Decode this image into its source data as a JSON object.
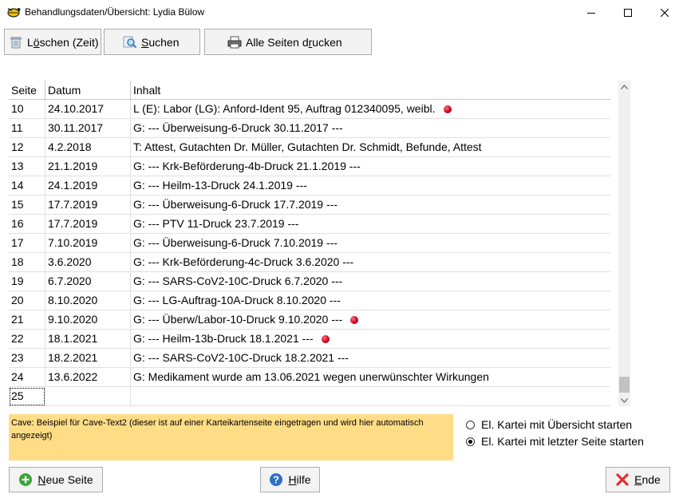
{
  "window": {
    "title": "Behandlungsdaten/Übersicht: Lydia Bülow"
  },
  "toolbar": {
    "delete_label_pre": "L",
    "delete_label_u": "ö",
    "delete_label_post": "schen (Zeit)",
    "search_label_pre": "",
    "search_label_u": "S",
    "search_label_post": "uchen",
    "print_label_pre": "Alle Seiten d",
    "print_label_u": "r",
    "print_label_post": "ucken"
  },
  "table": {
    "headers": [
      "Seite",
      "Datum",
      "Inhalt"
    ],
    "rows": [
      {
        "seite": "10",
        "datum": "24.10.2017",
        "inhalt": "L (E): Labor (LG): Anford-Ident 95, Auftrag 012340095, weibl.",
        "marker": true
      },
      {
        "seite": "11",
        "datum": "30.11.2017",
        "inhalt": "G: --- Überweisung-6-Druck 30.11.2017 ---",
        "marker": false
      },
      {
        "seite": "12",
        "datum": "4.2.2018",
        "inhalt": "T: Attest, Gutachten Dr. Müller, Gutachten Dr. Schmidt, Befunde, Attest",
        "marker": false
      },
      {
        "seite": "13",
        "datum": "21.1.2019",
        "inhalt": "G: --- Krk-Beförderung-4b-Druck 21.1.2019 ---",
        "marker": false
      },
      {
        "seite": "14",
        "datum": "24.1.2019",
        "inhalt": "G: --- Heilm-13-Druck 24.1.2019 ---",
        "marker": false
      },
      {
        "seite": "15",
        "datum": "17.7.2019",
        "inhalt": "G: --- Überweisung-6-Druck 17.7.2019 ---",
        "marker": false
      },
      {
        "seite": "16",
        "datum": "17.7.2019",
        "inhalt": "G: --- PTV 11-Druck 23.7.2019 ---",
        "marker": false
      },
      {
        "seite": "17",
        "datum": "7.10.2019",
        "inhalt": "G: --- Überweisung-6-Druck 7.10.2019 ---",
        "marker": false
      },
      {
        "seite": "18",
        "datum": "3.6.2020",
        "inhalt": "G: --- Krk-Beförderung-4c-Druck 3.6.2020 ---",
        "marker": false
      },
      {
        "seite": "19",
        "datum": "6.7.2020",
        "inhalt": "G: --- SARS-CoV2-10C-Druck 6.7.2020 ---",
        "marker": false
      },
      {
        "seite": "20",
        "datum": "8.10.2020",
        "inhalt": "G: --- LG-Auftrag-10A-Druck 8.10.2020 ---",
        "marker": false
      },
      {
        "seite": "21",
        "datum": "9.10.2020",
        "inhalt": "G: --- Überw/Labor-10-Druck 9.10.2020 ---",
        "marker": true
      },
      {
        "seite": "22",
        "datum": "18.1.2021",
        "inhalt": "G: --- Heilm-13b-Druck 18.1.2021 ---",
        "marker": true
      },
      {
        "seite": "23",
        "datum": "18.2.2021",
        "inhalt": "G: --- SARS-CoV2-10C-Druck 18.2.2021 ---",
        "marker": false
      },
      {
        "seite": "24",
        "datum": "13.6.2022",
        "inhalt": "G: Medikament wurde am 13.06.2021 wegen unerwünschter Wirkungen",
        "marker": false
      },
      {
        "seite": "25",
        "datum": "",
        "inhalt": "",
        "marker": false,
        "editing": true
      }
    ]
  },
  "cave": {
    "text": "Cave: Beispiel für Cave-Text2 (dieser ist auf einer Karteikartenseite eingetragen und wird hier automatisch angezeigt)"
  },
  "options": {
    "radio1_label": "El. Kartei mit Übersicht starten",
    "radio1_checked": false,
    "radio2_label": "El. Kartei mit letzter Seite starten",
    "radio2_checked": true
  },
  "footer": {
    "new_label_pre": "",
    "new_label_u": "N",
    "new_label_post": "eue Seite",
    "help_label_pre": "",
    "help_label_u": "H",
    "help_label_post": "ilfe",
    "end_label_pre": "",
    "end_label_u": "E",
    "end_label_post": "nde"
  },
  "colors": {
    "cave_bg": "#ffdd87",
    "marker": "#c4001c",
    "new_icon": "#3aa53a",
    "help_icon": "#2f6fc4",
    "end_icon": "#e03030"
  },
  "icons": {
    "app": "tortoise-icon",
    "delete": "trash-icon",
    "search": "search-icon",
    "print": "printer-icon",
    "new": "plus-circle-icon",
    "help": "help-icon",
    "end": "close-x-icon"
  }
}
